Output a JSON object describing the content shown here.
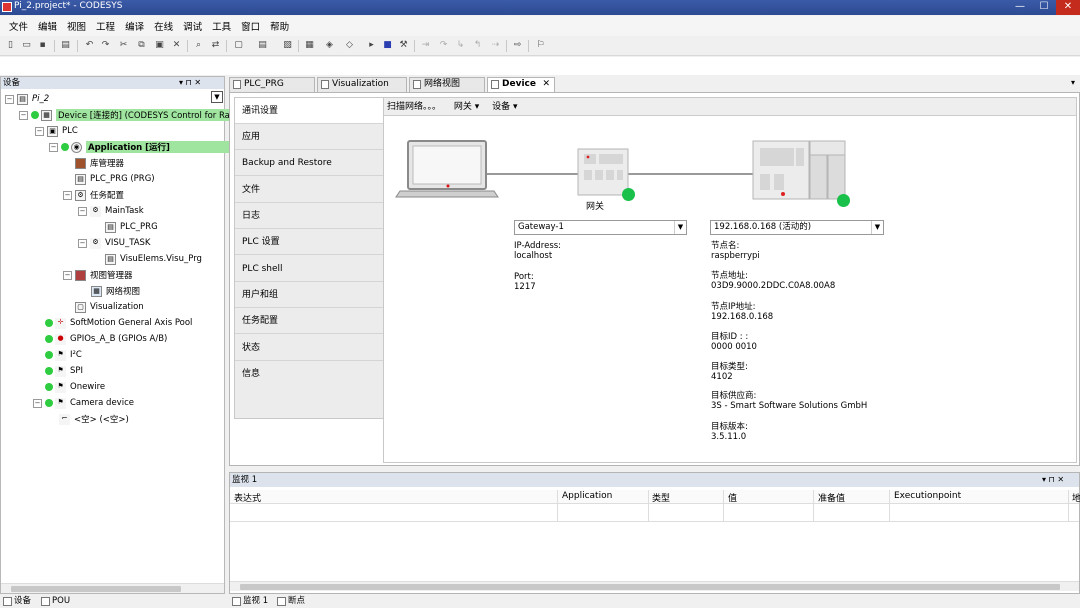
{
  "window": {
    "title": "Pi_2.project* - CODESYS",
    "min": "—",
    "max": "☐",
    "close": "✕"
  },
  "menu": [
    "文件",
    "编辑",
    "视图",
    "工程",
    "编译",
    "在线",
    "调试",
    "工具",
    "窗口",
    "帮助"
  ],
  "devices_panel": {
    "title": "设备",
    "pin": "▾ ⊓ ✕",
    "tree": [
      {
        "label": "Pi_2",
        "icon": "project-icon"
      },
      {
        "label": "Device [连接的] (CODESYS Control for Raspb",
        "icon": "device-icon"
      },
      {
        "label": "PLC",
        "icon": "plc-icon"
      },
      {
        "label": "Application [运行]",
        "icon": "application-icon"
      },
      {
        "label": "库管理器",
        "icon": "library-icon"
      },
      {
        "label": "PLC_PRG (PRG)",
        "icon": "pou-icon"
      },
      {
        "label": "任务配置",
        "icon": "task-config-icon"
      },
      {
        "label": "MainTask",
        "icon": "task-icon"
      },
      {
        "label": "PLC_PRG",
        "icon": "pou-call-icon"
      },
      {
        "label": "VISU_TASK",
        "icon": "task-icon"
      },
      {
        "label": "VisuElems.Visu_Prg",
        "icon": "pou-call-icon"
      },
      {
        "label": "视图管理器",
        "icon": "visu-manager-icon"
      },
      {
        "label": "网络视图",
        "icon": "network-view-icon"
      },
      {
        "label": "Visualization",
        "icon": "visualization-icon"
      },
      {
        "label": "SoftMotion General Axis Pool",
        "icon": "axis-pool-icon"
      },
      {
        "label": "GPIOs_A_B (GPIOs A/B)",
        "icon": "gpio-icon"
      },
      {
        "label": "I²C",
        "icon": "i2c-icon"
      },
      {
        "label": "SPI",
        "icon": "spi-icon"
      },
      {
        "label": "Onewire",
        "icon": "onewire-icon"
      },
      {
        "label": "Camera device",
        "icon": "camera-icon"
      },
      {
        "label": "<空> (<空>)",
        "icon": "empty-slot-icon"
      }
    ]
  },
  "editor_tabs": [
    {
      "label": "PLC_PRG"
    },
    {
      "label": "Visualization"
    },
    {
      "label": "网络视图"
    },
    {
      "label": "Device",
      "close": "✕"
    }
  ],
  "device_nav": [
    "通讯设置",
    "应用",
    "Backup and Restore",
    "文件",
    "日志",
    "PLC 设置",
    "PLC shell",
    "用户和组",
    "任务配置",
    "状态",
    "信息"
  ],
  "device_toolbar": {
    "scan": "扫描网络。。。",
    "gateway": "网关 ▾",
    "device": "设备 ▾"
  },
  "gateway": {
    "label": "网关",
    "selected": "Gateway-1",
    "ip_label": "IP-Address:",
    "ip_value": "localhost",
    "port_label": "Port:",
    "port_value": "1217"
  },
  "device": {
    "selected": "192.168.0.168 (活动的)",
    "fields": [
      {
        "label": "节点名:",
        "value": "raspberrypi"
      },
      {
        "label": "节点地址:",
        "value": "03D9.9000.2DDC.C0A8.00A8"
      },
      {
        "label": "节点IP地址:",
        "value": "192.168.0.168"
      },
      {
        "label": "目标ID : :",
        "value": "0000  0010"
      },
      {
        "label": "目标类型:",
        "value": "4102"
      },
      {
        "label": "目标供应商:",
        "value": "3S - Smart Software Solutions GmbH"
      },
      {
        "label": "目标版本:",
        "value": "3.5.11.0"
      }
    ]
  },
  "monitor": {
    "title": "监视 1",
    "controls": "▾ ⊓ ✕",
    "columns": [
      "表达式",
      "Application",
      "类型",
      "值",
      "准备值",
      "Executionpoint",
      "地"
    ]
  },
  "bottom_tabs_left": [
    "设备",
    "POU"
  ],
  "bottom_tabs_right": [
    "监视 1",
    "断点"
  ],
  "colors": {
    "title_bar": "#2d4a92",
    "status_green": "#19c04a",
    "highlight": "#9fe59f"
  }
}
